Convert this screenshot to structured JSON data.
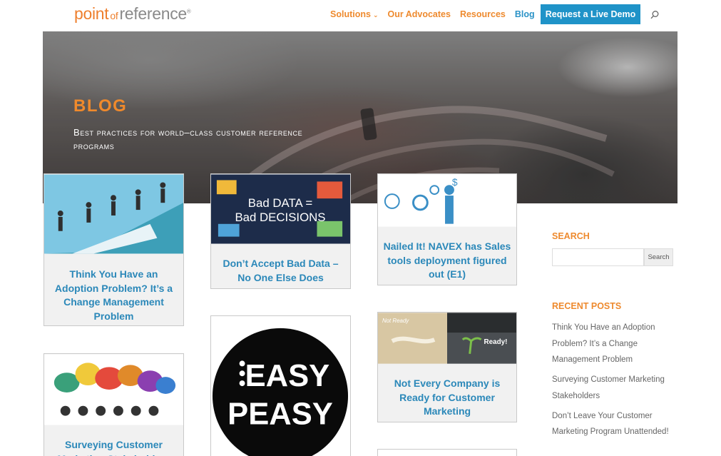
{
  "header": {
    "logo": {
      "part1": "point",
      "part2": "of",
      "part3": "reference",
      "mark": "®"
    },
    "nav": [
      {
        "label": "Solutions",
        "has_dropdown": true
      },
      {
        "label": "Our Advocates"
      },
      {
        "label": "Resources"
      },
      {
        "label": "Blog",
        "active": true
      }
    ],
    "cta_label": "Request a Live Demo"
  },
  "hero": {
    "title": "BLOG",
    "subtitle": "Best practices for world–class customer reference programs"
  },
  "cards": [
    {
      "title": "Think You Have an Adoption Problem? It’s a Change Management Problem"
    },
    {
      "title": "Don’t Accept Bad Data – No One Else Does",
      "image_text_1": "Bad DATA =",
      "image_text_2": "Bad DECISIONS"
    },
    {
      "title": "Nailed It! NAVEX has Sales tools deployment figured out (E1)"
    },
    {
      "title": "Surveying Customer Marketing Stakeholders"
    },
    {
      "title": "",
      "image_text_1": "EASY",
      "image_text_2": "PEASY"
    },
    {
      "title": "Not Every Company is Ready for Customer Marketing",
      "image_text_1": "Not Ready",
      "image_text_2": "Ready!"
    }
  ],
  "sidebar": {
    "search_heading": "SEARCH",
    "search_placeholder": "",
    "search_button": "Search",
    "recent_heading": "RECENT POSTS",
    "recent_posts": [
      "Think You Have an Adoption Problem? It’s a Change Management Problem",
      "Surveying Customer Marketing Stakeholders",
      "Don’t Leave Your Customer Marketing Program Unattended!"
    ]
  },
  "colors": {
    "orange": "#ee8a2e",
    "blue": "#2b88b9",
    "cta": "#1f93c8"
  }
}
